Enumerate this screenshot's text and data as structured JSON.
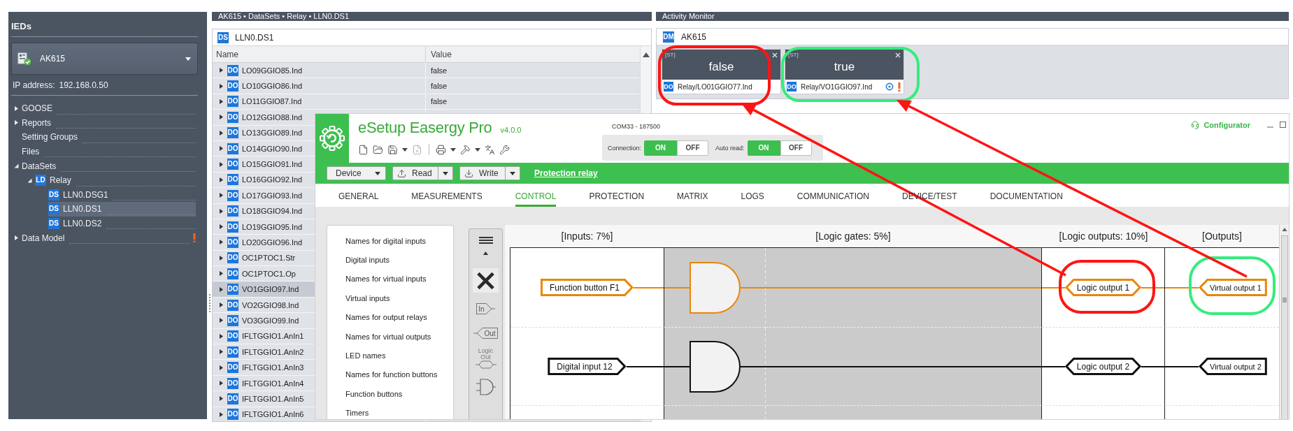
{
  "sidebar": {
    "title": "IEDs",
    "device": "AK615",
    "ip_label": "IP address:",
    "ip_value": "192.168.0.50",
    "tree": [
      {
        "label": "GOOSE",
        "kind": "branch",
        "expanded": false,
        "selected": false,
        "warning": false
      },
      {
        "label": "Reports",
        "kind": "branch",
        "expanded": false,
        "selected": false,
        "warning": false
      },
      {
        "label": "Setting Groups",
        "kind": "leaf",
        "selected": false,
        "warning": false
      },
      {
        "label": "Files",
        "kind": "leaf",
        "selected": false,
        "warning": false
      },
      {
        "label": "DataSets",
        "kind": "branch",
        "expanded": true,
        "selected": false,
        "warning": false,
        "children": [
          {
            "label": "Relay",
            "kind": "branch",
            "badge": "LD",
            "expanded": true,
            "selected": false,
            "warning": false,
            "children": [
              {
                "label": "LLN0.DSG1",
                "kind": "leaf",
                "badge": "DS",
                "selected": false,
                "warning": false
              },
              {
                "label": "LLN0.DS1",
                "kind": "leaf",
                "badge": "DS",
                "selected": true,
                "warning": false
              },
              {
                "label": "LLN0.DS2",
                "kind": "leaf",
                "badge": "DS",
                "selected": false,
                "warning": false
              }
            ]
          }
        ]
      },
      {
        "label": "Data Model",
        "kind": "branch",
        "expanded": false,
        "selected": false,
        "warning": true
      }
    ]
  },
  "dataset": {
    "breadcrumb": "AK615 • DataSets • Relay • LLN0.DS1",
    "badge": "DS",
    "title": "LLN0.DS1",
    "columns": [
      "Name",
      "Value"
    ],
    "rows": [
      {
        "badge": "DO",
        "name": "LO09GGIO85.Ind",
        "value": "false",
        "expanded": false,
        "selected": false
      },
      {
        "badge": "DO",
        "name": "LO10GGIO86.Ind",
        "value": "false",
        "expanded": false,
        "selected": false
      },
      {
        "badge": "DO",
        "name": "LO11GGIO87.Ind",
        "value": "false",
        "expanded": false,
        "selected": false
      },
      {
        "badge": "DO",
        "name": "LO12GGIO88.Ind",
        "expanded": false,
        "selected": false
      },
      {
        "badge": "DO",
        "name": "LO13GGIO89.Ind",
        "expanded": false,
        "selected": false
      },
      {
        "badge": "DO",
        "name": "LO14GGIO90.Ind",
        "expanded": false,
        "selected": false
      },
      {
        "badge": "DO",
        "name": "LO15GGIO91.Ind",
        "expanded": false,
        "selected": false
      },
      {
        "badge": "DO",
        "name": "LO16GGIO92.Ind",
        "expanded": false,
        "selected": false
      },
      {
        "badge": "DO",
        "name": "LO17GGIO93.Ind",
        "expanded": false,
        "selected": false
      },
      {
        "badge": "DO",
        "name": "LO18GGIO94.Ind",
        "expanded": false,
        "selected": false
      },
      {
        "badge": "DO",
        "name": "LO19GGIO95.Ind",
        "expanded": false,
        "selected": false
      },
      {
        "badge": "DO",
        "name": "LO20GGIO96.Ind",
        "expanded": false,
        "selected": false
      },
      {
        "badge": "DO",
        "name": "OC1PTOC1.Str",
        "expanded": false,
        "selected": false
      },
      {
        "badge": "DO",
        "name": "OC1PTOC1.Op",
        "expanded": false,
        "selected": false
      },
      {
        "badge": "DO",
        "name": "VO1GGIO97.Ind",
        "expanded": false,
        "selected": true
      },
      {
        "badge": "DO",
        "name": "VO2GGIO98.Ind",
        "expanded": false,
        "selected": false
      },
      {
        "badge": "DO",
        "name": "VO3GGIO99.Ind",
        "expanded": false,
        "selected": false
      },
      {
        "badge": "DO",
        "name": "IFLTGGIO1.AnIn1",
        "expanded": false,
        "selected": false
      },
      {
        "badge": "DO",
        "name": "IFLTGGIO1.AnIn2",
        "expanded": false,
        "selected": false
      },
      {
        "badge": "DO",
        "name": "IFLTGGIO1.AnIn3",
        "expanded": false,
        "selected": false
      },
      {
        "badge": "DO",
        "name": "IFLTGGIO1.AnIn4",
        "expanded": false,
        "selected": false
      },
      {
        "badge": "DO",
        "name": "IFLTGGIO1.AnIn5",
        "expanded": false,
        "selected": false
      },
      {
        "badge": "DO",
        "name": "IFLTGGIO1.AnIn6",
        "expanded": false,
        "selected": false
      }
    ]
  },
  "activity": {
    "title": "Activity Monitor",
    "badge": "DM",
    "device": "AK615",
    "cards": [
      {
        "tag": "[ST]",
        "value": "false",
        "badge": "DO",
        "path": "Relay/LO01GGIO77.Ind",
        "alert": false
      },
      {
        "tag": "[ST]",
        "value": "true",
        "badge": "DO",
        "path": "Relay/VO1GGIO97.Ind",
        "alert": true
      }
    ]
  },
  "esetup": {
    "title": "eSetup Easergy Pro",
    "version": "v4.0.0",
    "port": "COM33 - 187500",
    "switches": [
      {
        "label": "Connection:",
        "options": [
          {
            "label": "ON",
            "selected": true
          },
          {
            "label": "OFF",
            "selected": false
          }
        ]
      },
      {
        "label": "Auto read:",
        "options": [
          {
            "label": "ON",
            "selected": true
          },
          {
            "label": "OFF",
            "selected": false
          }
        ]
      }
    ],
    "configurator": "Configurator",
    "buttons": [
      {
        "kind": "dropdown",
        "label": "Device"
      },
      {
        "kind": "split",
        "label": "Read"
      },
      {
        "kind": "split",
        "label": "Write"
      }
    ],
    "link": "Protection relay",
    "tabs": [
      {
        "label": "GENERAL",
        "selected": false
      },
      {
        "label": "MEASUREMENTS",
        "selected": false
      },
      {
        "label": "CONTROL",
        "selected": true
      },
      {
        "label": "PROTECTION",
        "selected": false
      },
      {
        "label": "MATRIX",
        "selected": false
      },
      {
        "label": "LOGS",
        "selected": false
      },
      {
        "label": "COMMUNICATION",
        "selected": false
      },
      {
        "label": "DEVICE/TEST",
        "selected": false
      },
      {
        "label": "DOCUMENTATION",
        "selected": false
      }
    ],
    "menu": [
      {
        "label": "Names for digital inputs",
        "selected": false
      },
      {
        "label": "Digital inputs",
        "selected": false
      },
      {
        "label": "Names for virtual inputs",
        "selected": false
      },
      {
        "label": "Virtual inputs",
        "selected": false
      },
      {
        "label": "Names for output relays",
        "selected": false
      },
      {
        "label": "Names for virtual outputs",
        "selected": false
      },
      {
        "label": "LED names",
        "selected": false
      },
      {
        "label": "Names for function buttons",
        "selected": false
      },
      {
        "label": "Function buttons",
        "selected": false
      },
      {
        "label": "Timers",
        "selected": false
      }
    ],
    "palette": [
      {
        "kind": "menu"
      },
      {
        "kind": "scroll"
      },
      {
        "kind": "delete"
      },
      {
        "kind": "input",
        "label": "In"
      },
      {
        "kind": "output",
        "label": "Out"
      },
      {
        "kind": "logic-output",
        "label": "Logic Out"
      },
      {
        "kind": "and-gate"
      }
    ],
    "diagram": {
      "columns": [
        "[Inputs: 7%]",
        "[Logic gates: 5%]",
        "[Logic outputs: 10%]",
        "[Outputs]"
      ],
      "rows": [
        {
          "active": true,
          "input": "Function button F1",
          "logic_output": "Logic output 1",
          "output": "Virtual output 1"
        },
        {
          "active": false,
          "input": "Digital input 12",
          "logic_output": "Logic output 2",
          "output": "Virtual output 2"
        }
      ]
    }
  },
  "annotations": [
    {
      "kind": "circle",
      "color": "#ff1414"
    },
    {
      "kind": "circle",
      "color": "#35ec7c"
    },
    {
      "kind": "circle",
      "color": "#ff1414"
    },
    {
      "kind": "circle",
      "color": "#35ec7c"
    },
    {
      "kind": "arrow",
      "color": "#ff1414"
    },
    {
      "kind": "arrow",
      "color": "#ff1414"
    }
  ]
}
